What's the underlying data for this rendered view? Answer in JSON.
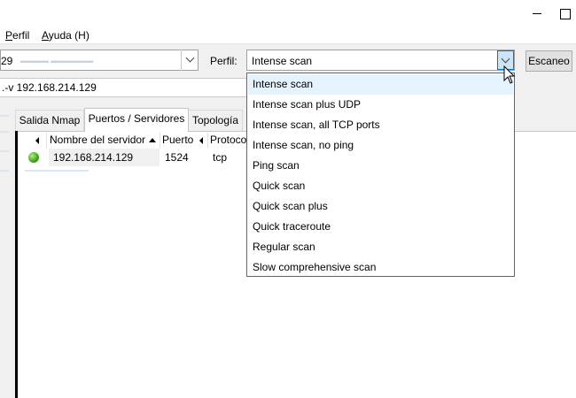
{
  "menu": {
    "profile": "Perfil",
    "help": "Ayuda (H)"
  },
  "toolbar": {
    "target_value": "29",
    "profile_label": "Perfil:",
    "profile_value": "Intense scan",
    "scan_button": "Escaneo"
  },
  "command": {
    "value": ".-v 192.168.214.129"
  },
  "tabs": [
    {
      "label": "Salida Nmap"
    },
    {
      "label": "Puertos / Servidores"
    },
    {
      "label": "Topología"
    }
  ],
  "columns": {
    "server": "Nombre del servidor",
    "port": "Puerto",
    "protocol": "Protoco"
  },
  "rows": [
    {
      "host": "192.168.214.129",
      "port": "1524",
      "protocol": "tcp"
    }
  ],
  "profiles": [
    "Intense scan",
    "Intense scan plus UDP",
    "Intense scan, all TCP ports",
    "Intense scan, no ping",
    "Ping scan",
    "Quick scan",
    "Quick scan plus",
    "Quick traceroute",
    "Regular scan",
    "Slow comprehensive scan"
  ],
  "colors": {
    "highlight": "#e5f3ff",
    "accent": "#0078d7",
    "status_up": "#3fa11b"
  },
  "icons": {
    "host_status": "host-up-icon",
    "dropdown": "chevron-down-icon"
  }
}
